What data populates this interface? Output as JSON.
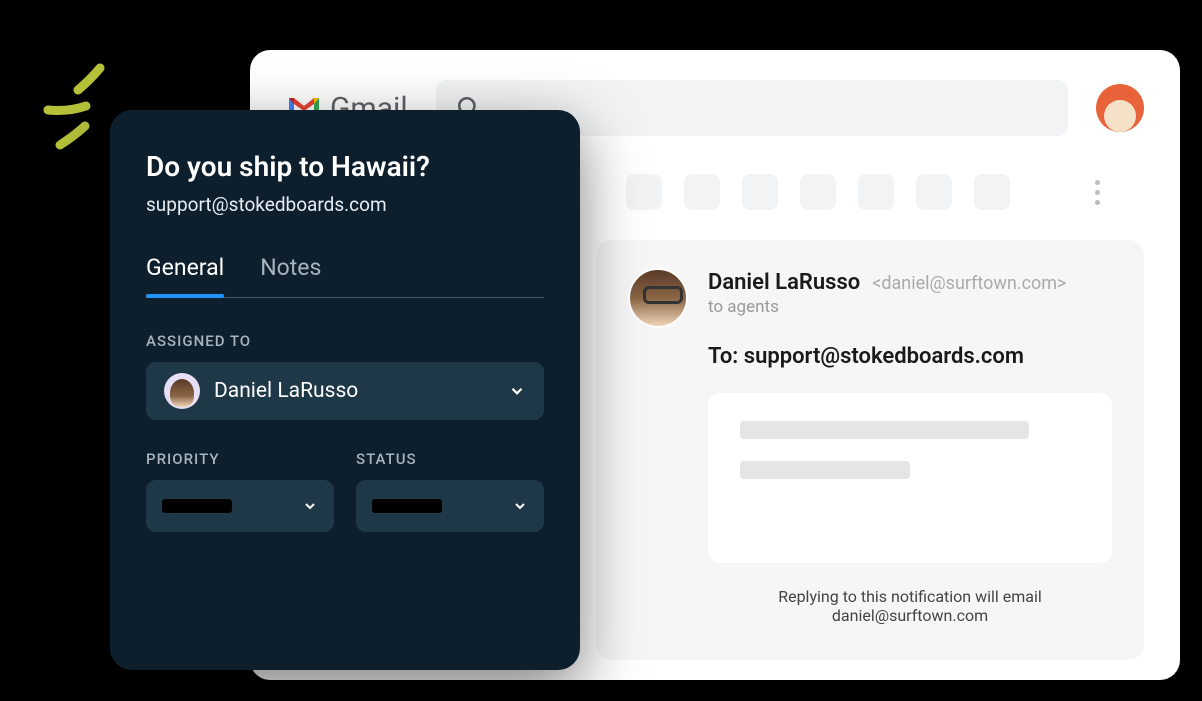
{
  "gmail": {
    "brand": "Gmail",
    "sender": {
      "name": "Daniel LaRusso",
      "email": "<daniel@surftown.com>",
      "recipients_line": "to agents"
    },
    "to_line": "To: support@stokedboards.com",
    "reply_hint": "Replying to this notification will email daniel@surftown.com"
  },
  "ticket": {
    "title": "Do you ship to Hawaii?",
    "subtitle": "support@stokedboards.com",
    "tabs": {
      "general": "General",
      "notes": "Notes"
    },
    "fields": {
      "assigned_label": "ASSIGNED TO",
      "assigned_value": "Daniel LaRusso",
      "priority_label": "PRIORITY",
      "status_label": "STATUS"
    }
  }
}
